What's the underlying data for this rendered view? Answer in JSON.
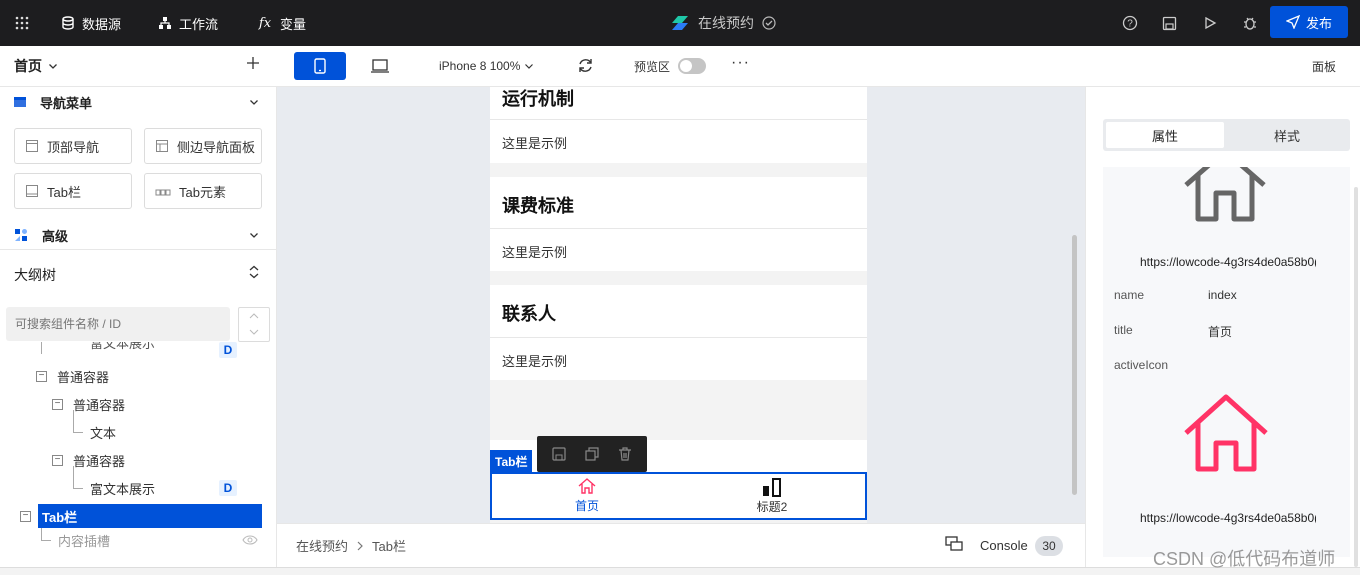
{
  "topbar": {
    "datasource": "数据源",
    "workflow": "工作流",
    "variable": "变量",
    "app_name": "在线预约",
    "publish": "发布"
  },
  "toolbar": {
    "page": "首页",
    "device": "iPhone 8 100%",
    "preview": "预览区",
    "panel": "面板"
  },
  "left": {
    "nav_section": "导航菜单",
    "components": [
      "顶部导航",
      "侧边导航面板",
      "Tab栏",
      "Tab元素"
    ],
    "advanced_section": "高级",
    "outline": "大纲树",
    "search_placeholder": "可搜索组件名称 / ID",
    "tree": {
      "partial": "富文本展示",
      "container1": "普通容器",
      "container2": "普通容器",
      "text": "文本",
      "container3": "普通容器",
      "richtext": "富文本展示",
      "tabbar": "Tab栏",
      "slot": "内容插槽",
      "badge": "D"
    }
  },
  "canvas": {
    "cards": [
      {
        "title": "运行机制",
        "text": "这里是示例"
      },
      {
        "title": "课费标准",
        "text": "这里是示例"
      },
      {
        "title": "联系人",
        "text": "这里是示例"
      }
    ],
    "selected_label": "Tab栏",
    "tabs": [
      {
        "label": "首页",
        "icon": "home-icon"
      },
      {
        "label": "标题2",
        "icon": "chart-icon"
      }
    ]
  },
  "bottom": {
    "crumb_root": "在线预约",
    "crumb_current": "Tab栏",
    "console": "Console",
    "count": "30"
  },
  "right": {
    "tab_props": "属性",
    "tab_style": "样式",
    "url1": "https://lowcode-4g3rs4de0a58b0(",
    "name_label": "name",
    "name_value": "index",
    "title_label": "title",
    "title_value": "首页",
    "activeicon_label": "activeIcon",
    "url2": "https://lowcode-4g3rs4de0a58b0("
  },
  "watermark": "CSDN @低代码布道师",
  "colors": {
    "primary": "#0052d9",
    "active_icon": "#ff3366",
    "topbar": "#1d1d1f"
  }
}
